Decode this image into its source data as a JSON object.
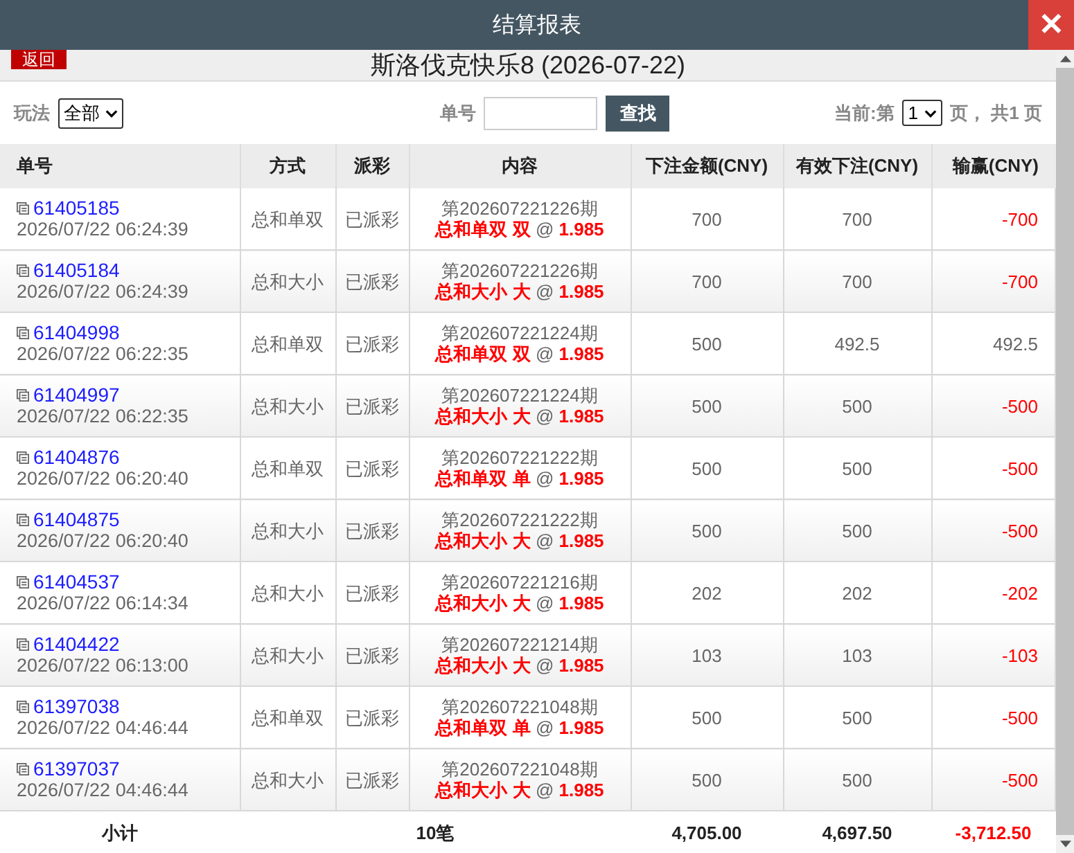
{
  "window": {
    "title": "结算报表",
    "close": "✕"
  },
  "back_button": "返回",
  "report_title": "斯洛伐克快乐8 (2026-07-22)",
  "filters": {
    "play_label": "玩法",
    "play_value": "全部",
    "order_label": "单号",
    "search_button": "查找",
    "page_prefix": "当前:第",
    "page_value": "1",
    "page_suffix": "页， 共1 页"
  },
  "table": {
    "columns": [
      "单号",
      "方式",
      "派彩",
      "内容",
      "下注金额(CNY)",
      "有效下注(CNY)",
      "输赢(CNY)"
    ],
    "rows": [
      {
        "order": "61405185",
        "time": "2026/07/22 06:24:39",
        "method": "总和单双",
        "payout": "已派彩",
        "period": "第202607221226期",
        "bet": "**总和单双 双** @ **1.985**",
        "amount": "700",
        "valid": "700",
        "result": "-700",
        "loss": true
      },
      {
        "order": "61405184",
        "time": "2026/07/22 06:24:39",
        "method": "总和大小",
        "payout": "已派彩",
        "period": "第202607221226期",
        "bet": "**总和大小 大** @ **1.985**",
        "amount": "700",
        "valid": "700",
        "result": "-700",
        "loss": true
      },
      {
        "order": "61404998",
        "time": "2026/07/22 06:22:35",
        "method": "总和单双",
        "payout": "已派彩",
        "period": "第202607221224期",
        "bet": "**总和单双 双** @ **1.985**",
        "amount": "500",
        "valid": "492.5",
        "result": "492.5",
        "loss": false
      },
      {
        "order": "61404997",
        "time": "2026/07/22 06:22:35",
        "method": "总和大小",
        "payout": "已派彩",
        "period": "第202607221224期",
        "bet": "**总和大小 大** @ **1.985**",
        "amount": "500",
        "valid": "500",
        "result": "-500",
        "loss": true
      },
      {
        "order": "61404876",
        "time": "2026/07/22 06:20:40",
        "method": "总和单双",
        "payout": "已派彩",
        "period": "第202607221222期",
        "bet": "**总和单双 单** @ **1.985**",
        "amount": "500",
        "valid": "500",
        "result": "-500",
        "loss": true
      },
      {
        "order": "61404875",
        "time": "2026/07/22 06:20:40",
        "method": "总和大小",
        "payout": "已派彩",
        "period": "第202607221222期",
        "bet": "**总和大小 大** @ **1.985**",
        "amount": "500",
        "valid": "500",
        "result": "-500",
        "loss": true
      },
      {
        "order": "61404537",
        "time": "2026/07/22 06:14:34",
        "method": "总和大小",
        "payout": "已派彩",
        "period": "第202607221216期",
        "bet": "**总和大小 大** @ **1.985**",
        "amount": "202",
        "valid": "202",
        "result": "-202",
        "loss": true
      },
      {
        "order": "61404422",
        "time": "2026/07/22 06:13:00",
        "method": "总和大小",
        "payout": "已派彩",
        "period": "第202607221214期",
        "bet": "**总和大小 大** @ **1.985**",
        "amount": "103",
        "valid": "103",
        "result": "-103",
        "loss": true
      },
      {
        "order": "61397038",
        "time": "2026/07/22 04:46:44",
        "method": "总和单双",
        "payout": "已派彩",
        "period": "第202607221048期",
        "bet": "**总和单双 单** @ **1.985**",
        "amount": "500",
        "valid": "500",
        "result": "-500",
        "loss": true
      },
      {
        "order": "61397037",
        "time": "2026/07/22 04:46:44",
        "method": "总和大小",
        "payout": "已派彩",
        "period": "第202607221048期",
        "bet": "**总和大小 大** @ **1.985**",
        "amount": "500",
        "valid": "500",
        "result": "-500",
        "loss": true
      }
    ],
    "totals": {
      "label": "小计",
      "count": "10笔",
      "amount": "4,705.00",
      "valid": "4,697.50",
      "result": "-3,712.50",
      "loss": true
    }
  }
}
